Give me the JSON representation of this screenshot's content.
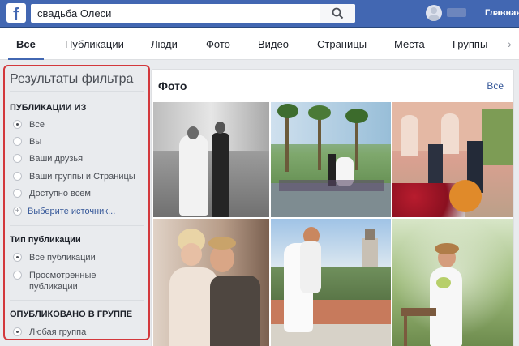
{
  "header": {
    "logo": "f",
    "search_value": "свадьба Олеси",
    "search_icon": "search-icon",
    "home_label": "Главная"
  },
  "tabs": [
    {
      "label": "Все",
      "active": true
    },
    {
      "label": "Публикации"
    },
    {
      "label": "Люди"
    },
    {
      "label": "Фото"
    },
    {
      "label": "Видео"
    },
    {
      "label": "Страницы"
    },
    {
      "label": "Места"
    },
    {
      "label": "Группы"
    }
  ],
  "filters": {
    "title": "Результаты фильтра",
    "posts_from": {
      "heading": "ПУБЛИКАЦИИ ИЗ",
      "options": [
        "Все",
        "Вы",
        "Ваши друзья",
        "Ваши группы и Страницы",
        "Доступно всем"
      ],
      "selected": "Все",
      "choose_source": "Выберите источник..."
    },
    "post_type": {
      "heading": "Тип публикации",
      "options": [
        "Все публикации",
        "Просмотренные публикации"
      ],
      "selected": "Все публикации"
    },
    "posted_in_group": {
      "heading": "ОПУБЛИКОВАНО В ГРУППЕ",
      "options": [
        "Любая группа"
      ],
      "selected": "Любая группа"
    }
  },
  "photos": {
    "title": "Фото",
    "see_all": "Все"
  },
  "colors": {
    "brand_blue": "#4267b2",
    "highlight_red": "#d3383c",
    "link_blue": "#365899"
  }
}
